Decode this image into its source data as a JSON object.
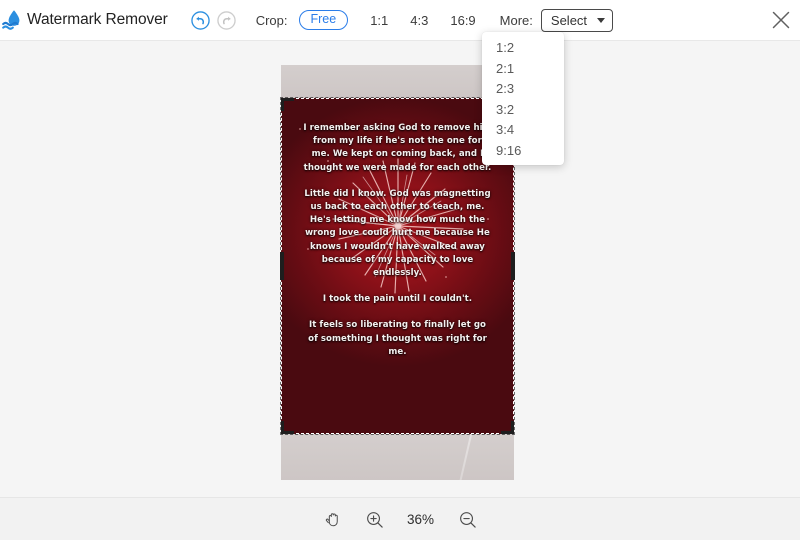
{
  "app": {
    "title": "Watermark Remover",
    "logo_icon": "water-drop-wave-logo"
  },
  "toolbar": {
    "undo_icon": "undo-circle-icon",
    "redo_icon": "redo-circle-icon",
    "crop_label": "Crop:",
    "ratios": [
      {
        "label": "Free",
        "selected": true
      },
      {
        "label": "1:1",
        "selected": false
      },
      {
        "label": "4:3",
        "selected": false
      },
      {
        "label": "16:9",
        "selected": false
      }
    ],
    "more_label": "More:",
    "select": {
      "value": "Select",
      "caret_icon": "chevron-down-icon",
      "options": [
        "1:2",
        "2:1",
        "2:3",
        "3:2",
        "3:4",
        "9:16"
      ],
      "expanded": true
    },
    "close_icon": "close-icon",
    "accent_color": "#2b7de9"
  },
  "canvas": {
    "image": {
      "alt_name": "fireworks-quote-photo",
      "background_color": "#8d1119",
      "band_color": "#cfc9c9",
      "quote_paragraphs": [
        "I remember asking God to remove him from my life if he's not the one for me. We kept on coming back, and I thought we were made for each other.",
        "Little did I know. God was magnetting us back to each other to teach, me. He's letting me know how much the wrong love could hurt me because He knows I wouldn't have walked away because of my capacity to love endlessly.",
        "I took the pain until I couldn't.",
        "It feels so liberating to finally let go of something I thought was right for me."
      ]
    },
    "crop_selection": {
      "name": "crop-selection-box",
      "style": "dashed"
    },
    "background_color": "#f5f5f5"
  },
  "footer": {
    "pan_icon": "hand-pan-icon",
    "zoom_in_icon": "zoom-in-icon",
    "zoom_out_icon": "zoom-out-icon",
    "zoom_level": "36%"
  }
}
